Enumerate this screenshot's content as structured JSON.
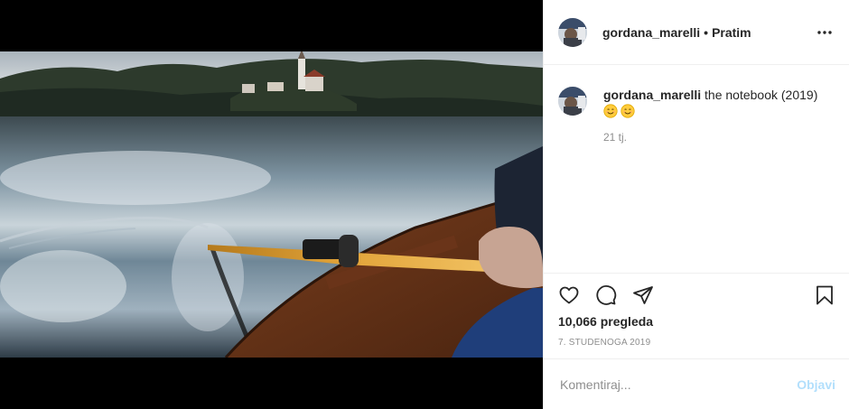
{
  "post": {
    "username": "gordana_marelli",
    "separator": "•",
    "follow_label": "Pratim",
    "caption_text": "the notebook (2019)",
    "caption_emojis": [
      "smiling-face-emoji",
      "smiling-face-emoji"
    ],
    "time_ago": "21 tj.",
    "views": "10,066 pregleda",
    "date": "7. STUDENOGA 2019"
  },
  "comment": {
    "placeholder": "Komentiraj...",
    "post_label": "Objavi"
  },
  "icons": {
    "more": "more-options-icon",
    "like": "heart-icon",
    "comment": "comment-icon",
    "share": "paper-plane-icon",
    "save": "bookmark-icon"
  },
  "colors": {
    "post_button_disabled": "#b2dffc",
    "secondary_text": "#8e8e8e",
    "primary_text": "#262626",
    "divider": "#efefef"
  }
}
